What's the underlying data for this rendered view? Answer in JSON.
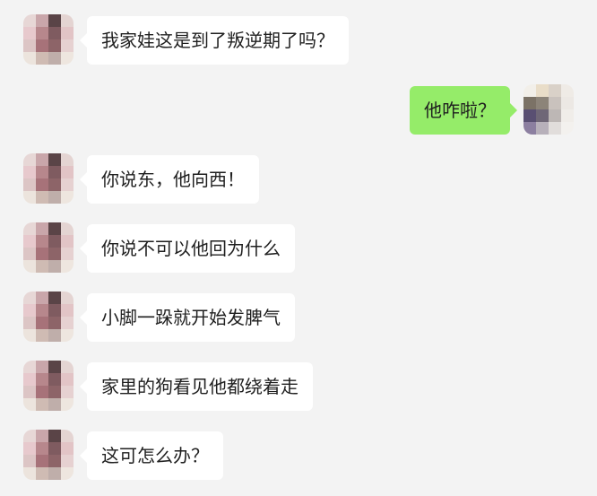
{
  "chat": {
    "background_color": "#f3f3f3",
    "incoming_bubble_color": "#ffffff",
    "outgoing_bubble_color": "#95ec69",
    "messages": [
      {
        "side": "in",
        "text": "我家娃这是到了叛逆期了吗？"
      },
      {
        "side": "out",
        "text": "他咋啦？"
      },
      {
        "side": "in",
        "text": "你说东，他向西！"
      },
      {
        "side": "in",
        "text": "你说不可以他回为什么"
      },
      {
        "side": "in",
        "text": "小脚一跺就开始发脾气"
      },
      {
        "side": "in",
        "text": "家里的狗看见他都绕着走"
      },
      {
        "side": "in",
        "text": "这可怎么办？"
      }
    ],
    "contact_avatar": {
      "icon": "pixelated-avatar-icon",
      "colors": [
        "#e7d7d6",
        "#c9a6aa",
        "#5a4447",
        "#e4d4d2",
        "#e7c9cd",
        "#b7878c",
        "#7f5b60",
        "#e2c4c6",
        "#dcc5c5",
        "#a77279",
        "#8d6468",
        "#e6d1d1",
        "#ece4dd",
        "#cfbbb3",
        "#bfaeaa",
        "#eee6df"
      ]
    },
    "self_avatar": {
      "icon": "pixelated-avatar-icon",
      "colors": [
        "#f2efe9",
        "#e9ddc8",
        "#d9d1c8",
        "#efebe6",
        "#7b7266",
        "#8c8479",
        "#c9c2bd",
        "#ece8e4",
        "#594f72",
        "#6f6777",
        "#bdb7b5",
        "#f0ede9",
        "#8c7fa0",
        "#b7b0ba",
        "#e1dddb",
        "#f3f1ee"
      ]
    }
  }
}
